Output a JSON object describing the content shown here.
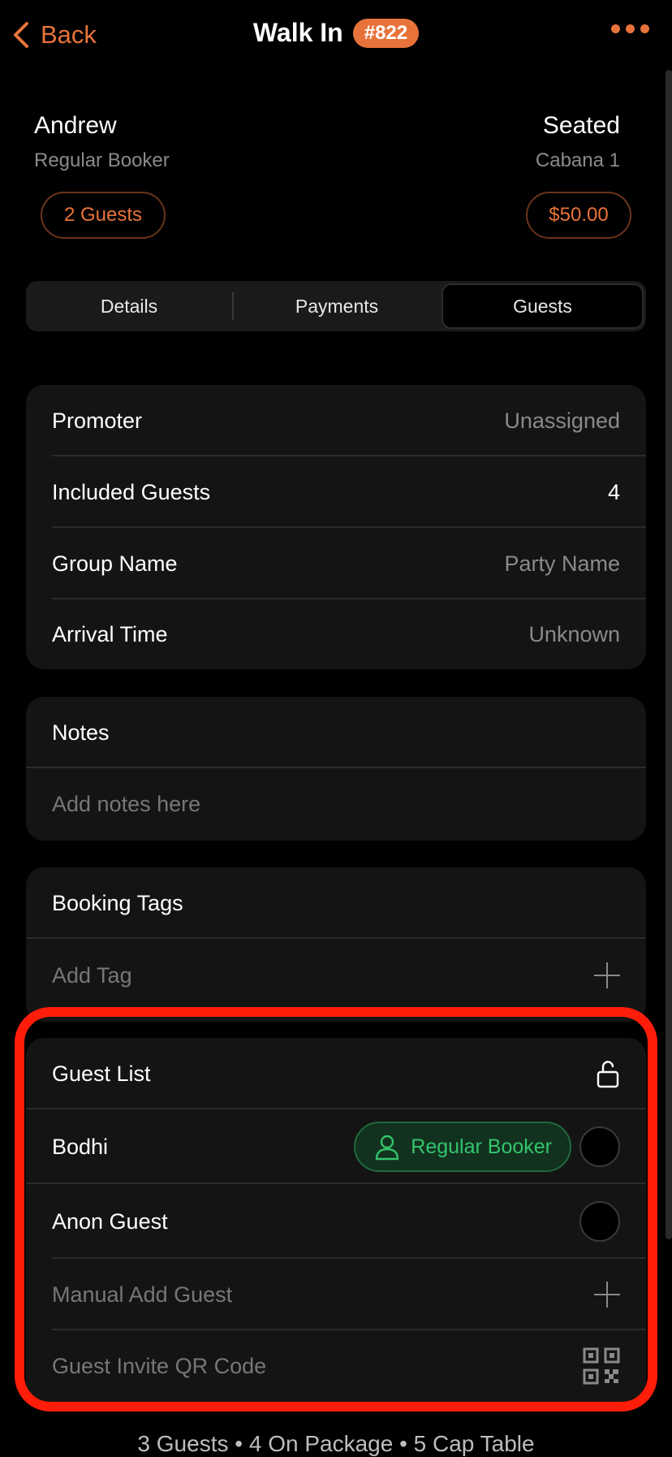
{
  "topbar": {
    "back_label": "Back",
    "title": "Walk In",
    "badge": "#822"
  },
  "booking": {
    "name": "Andrew",
    "subtitle": "Regular Booker",
    "guests_pill": "2 Guests",
    "status": "Seated",
    "location": "Cabana 1",
    "amount_pill": "$50.00"
  },
  "tabs": [
    {
      "label": "Details"
    },
    {
      "label": "Payments"
    },
    {
      "label": "Guests"
    }
  ],
  "active_tab": "Guests",
  "info": {
    "promoter_label": "Promoter",
    "promoter_value": "Unassigned",
    "included_label": "Included Guests",
    "included_value": "4",
    "group_label": "Group Name",
    "group_placeholder": "Party Name",
    "arrival_label": "Arrival Time",
    "arrival_value": "Unknown"
  },
  "notes": {
    "title": "Notes",
    "placeholder": "Add notes here"
  },
  "tags": {
    "title": "Booking Tags",
    "add_label": "Add Tag"
  },
  "guest_list": {
    "title": "Guest List",
    "guests": [
      {
        "name": "Bodhi",
        "badge": "Regular Booker"
      },
      {
        "name": "Anon Guest"
      }
    ],
    "manual_add": "Manual Add Guest",
    "qr_label": "Guest Invite QR Code"
  },
  "footer": "3 Guests • 4 On Package • 5 Cap Table",
  "colors": {
    "accent": "#e8733a",
    "highlight": "#ff1d0a",
    "booker_green": "#34c46c"
  },
  "icons": [
    "chevron-left-icon",
    "more-icon",
    "plus-icon",
    "unlock-icon",
    "person-icon",
    "qr-code-icon"
  ]
}
